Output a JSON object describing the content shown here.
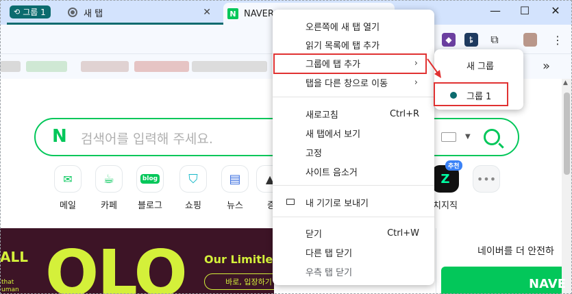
{
  "tabstrip": {
    "group_label": "그룹 1",
    "tabs": [
      {
        "title": "새 탭",
        "close": "✕"
      },
      {
        "title": "NAVER"
      }
    ]
  },
  "window_controls": {
    "minimize": "—",
    "maximize": "☐",
    "close": "✕"
  },
  "toolbar": {
    "more": "»"
  },
  "search": {
    "placeholder": "검색어를 입력해 주세요.",
    "logo": "N"
  },
  "shortcuts": [
    {
      "label": "메일"
    },
    {
      "label": "카페"
    },
    {
      "label": "블로그",
      "icon_text": "blog"
    },
    {
      "label": "쇼핑"
    },
    {
      "label": "뉴스"
    },
    {
      "label": "증"
    },
    {
      "label": "치지직",
      "badge": "추천"
    },
    {
      "label": ""
    }
  ],
  "banner": {
    "left_text": "ALL",
    "small_text": "that\numan",
    "big_text": "OLO",
    "headline": "Our Limitless",
    "button": "바로, 입장하기"
  },
  "side": {
    "safe_text": "네이버를 더 안전하",
    "login_btn": "NAVE"
  },
  "context_menu": {
    "items": [
      {
        "label": "오른쪽에 새 탭 열기"
      },
      {
        "label": "읽기 목록에 탭 추가"
      },
      {
        "label": "그룹에 탭 추가",
        "arrow": "›"
      },
      {
        "label": "탭을 다른 창으로 이동",
        "arrow": "›"
      },
      {
        "label": "새로고침",
        "shortcut": "Ctrl+R"
      },
      {
        "label": "새 탭에서 보기"
      },
      {
        "label": "고정"
      },
      {
        "label": "사이트 음소거"
      },
      {
        "label": "내 기기로 보내기"
      },
      {
        "label": "닫기",
        "shortcut": "Ctrl+W"
      },
      {
        "label": "다른 탭 닫기"
      },
      {
        "label": "우측 탭 닫기"
      }
    ]
  },
  "submenu": {
    "new_group": "새 그룹",
    "group1": "그룹 1"
  },
  "colors": {
    "group": "#0b6b6e",
    "naver": "#03c75a",
    "highlight": "#e03131"
  }
}
